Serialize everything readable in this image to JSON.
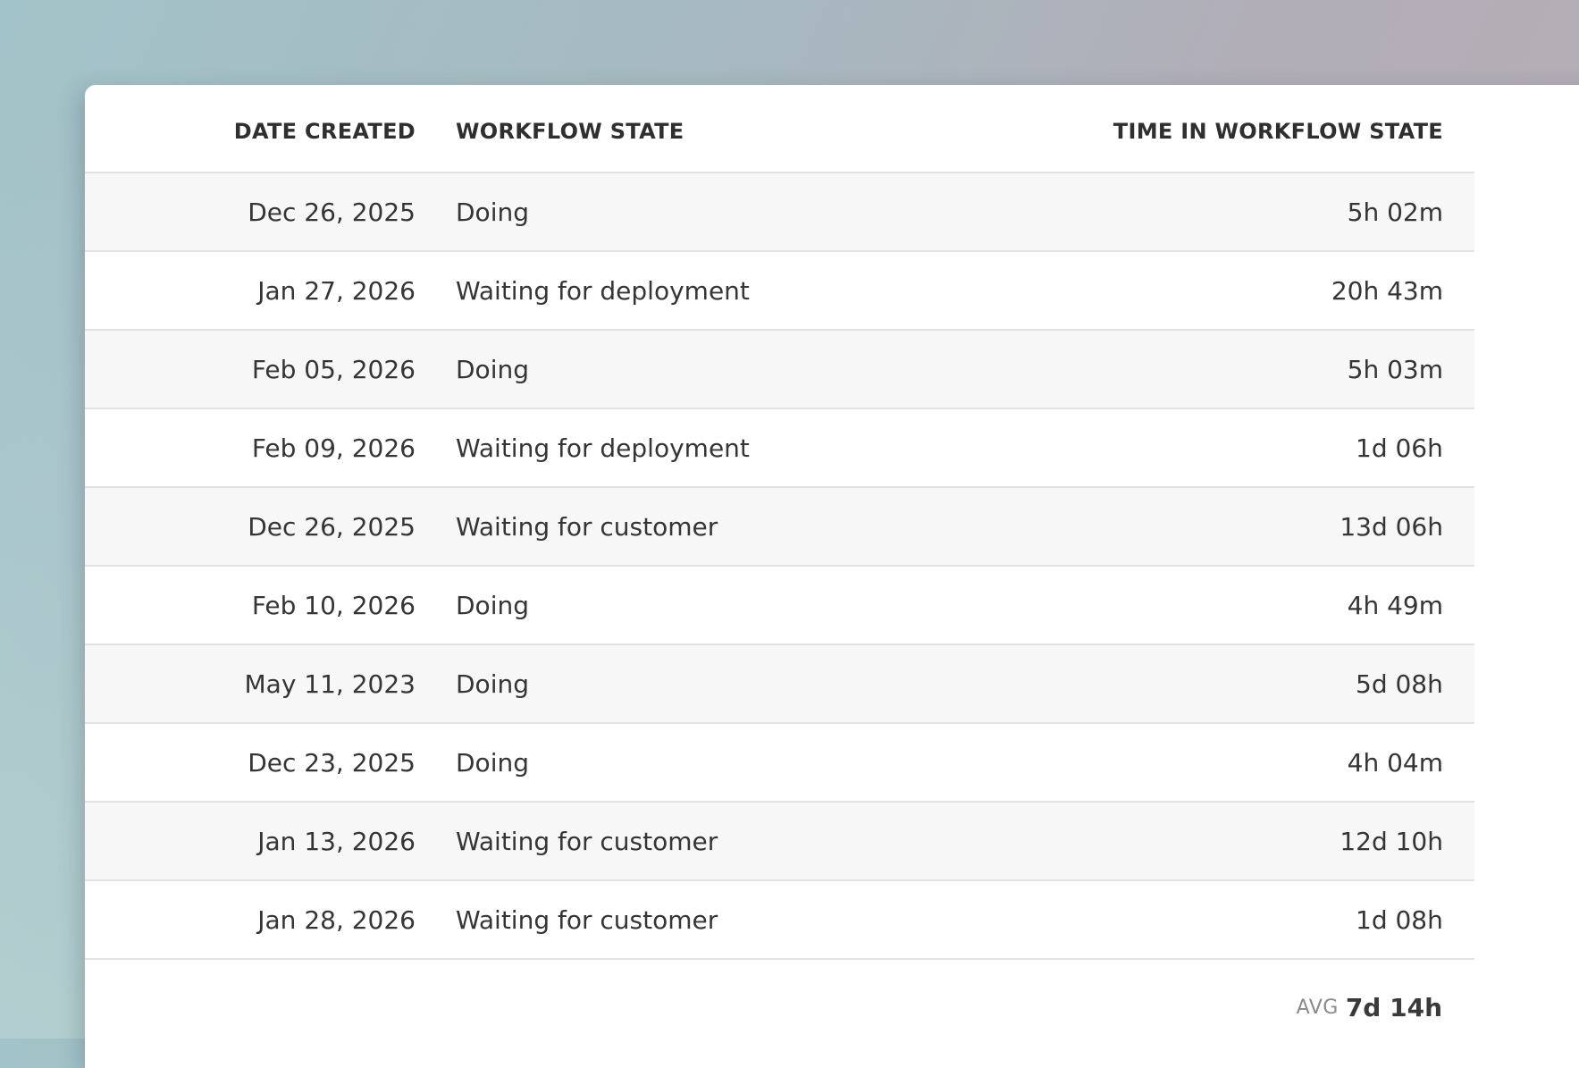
{
  "table": {
    "headers": {
      "date_created": "DATE CREATED",
      "workflow_state": "WORKFLOW STATE",
      "time_in_state": "TIME IN WORKFLOW STATE"
    },
    "rows": [
      {
        "date": "Dec 26, 2025",
        "state": "Doing",
        "time": "5h 02m"
      },
      {
        "date": "Jan 27, 2026",
        "state": "Waiting for deployment",
        "time": "20h 43m"
      },
      {
        "date": "Feb 05, 2026",
        "state": "Doing",
        "time": "5h 03m"
      },
      {
        "date": "Feb 09, 2026",
        "state": "Waiting for deployment",
        "time": "1d 06h"
      },
      {
        "date": "Dec 26, 2025",
        "state": "Waiting for customer",
        "time": "13d 06h"
      },
      {
        "date": "Feb 10, 2026",
        "state": "Doing",
        "time": "4h 49m"
      },
      {
        "date": "May 11, 2023",
        "state": "Doing",
        "time": "5d 08h"
      },
      {
        "date": "Dec 23, 2025",
        "state": "Doing",
        "time": "4h 04m"
      },
      {
        "date": "Jan 13, 2026",
        "state": "Waiting for customer",
        "time": "12d 10h"
      },
      {
        "date": "Jan 28, 2026",
        "state": "Waiting for customer",
        "time": "1d 08h"
      }
    ],
    "footer": {
      "avg_label": "AVG",
      "avg_value": "7d 14h"
    }
  },
  "colors": {
    "row_shade": "#f7f7f7",
    "divider": "#e2e2e2",
    "text": "#353535"
  }
}
